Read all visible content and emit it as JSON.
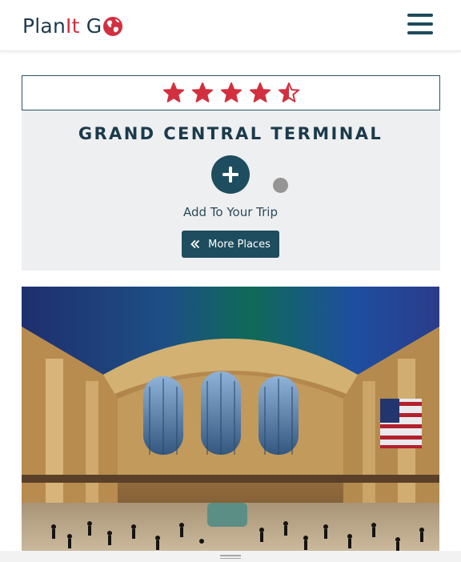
{
  "header": {
    "logo_plan": "Plan",
    "logo_it": "It",
    "logo_go": "G",
    "menu_icon": "hamburger-icon"
  },
  "rating": {
    "value": 4.5,
    "max": 5,
    "star_color": "#d2303f"
  },
  "place": {
    "title": "GRAND CENTRAL TERMINAL",
    "add_label": "Add To Your Trip",
    "more_button_label": "More Places",
    "more_button_icon": "double-chevron-left-icon",
    "add_button_icon": "plus-icon",
    "photo_subject": "grand-central-terminal-main-concourse-photo"
  },
  "colors": {
    "brand_dark": "#1d4d5e",
    "brand_red": "#d2303f",
    "card_bg": "#eeeff1"
  }
}
